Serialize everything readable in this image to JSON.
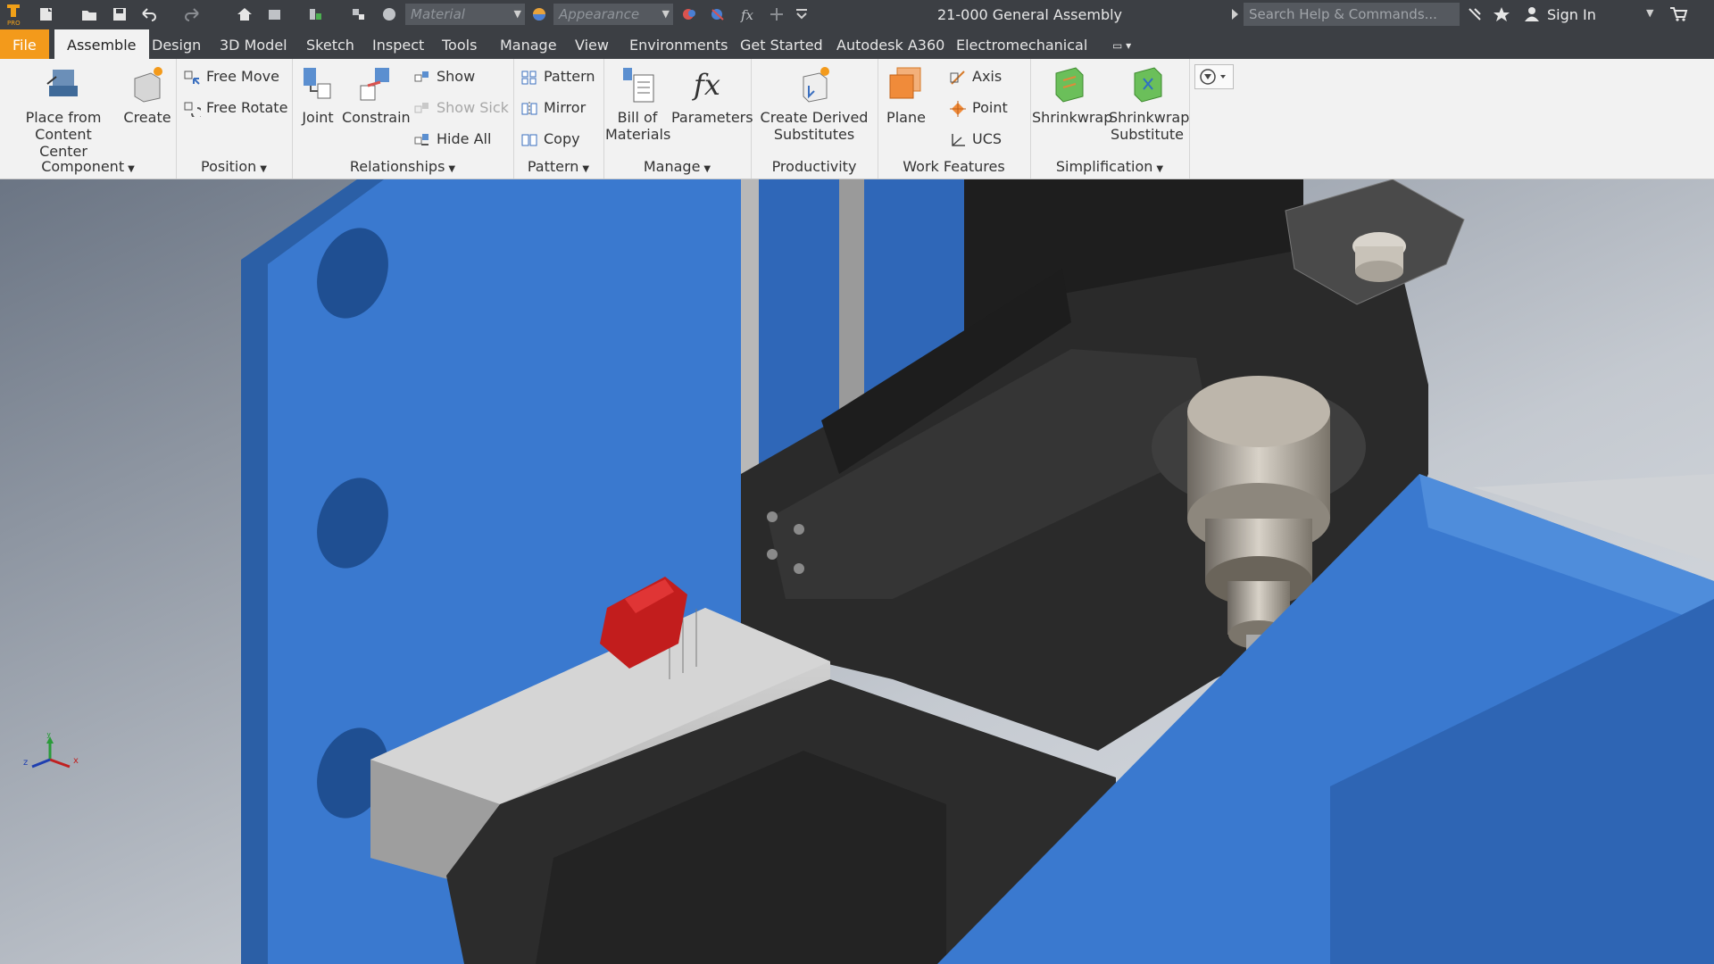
{
  "qat": {
    "material_placeholder": "Material",
    "appearance_placeholder": "Appearance",
    "document_title": "21-000 General Assembly",
    "search_placeholder": "Search Help & Commands...",
    "sign_in": "Sign In"
  },
  "tabs": [
    "File",
    "Assemble",
    "Design",
    "3D Model",
    "Sketch",
    "Inspect",
    "Tools",
    "Manage",
    "View",
    "Environments",
    "Get Started",
    "Autodesk A360",
    "Electromechanical"
  ],
  "active_tab": "Assemble",
  "ribbon": {
    "component": {
      "label": "Component",
      "place_l1": "Place from",
      "place_l2": "Content Center",
      "create": "Create"
    },
    "position": {
      "label": "Position",
      "free_move": "Free Move",
      "free_rotate": "Free Rotate"
    },
    "relationships": {
      "label": "Relationships",
      "joint": "Joint",
      "constrain": "Constrain",
      "show": "Show",
      "show_sick": "Show Sick",
      "hide_all": "Hide All"
    },
    "pattern": {
      "label": "Pattern",
      "pattern": "Pattern",
      "mirror": "Mirror",
      "copy": "Copy"
    },
    "manage": {
      "label": "Manage",
      "bom_l1": "Bill of",
      "bom_l2": "Materials",
      "parameters": "Parameters"
    },
    "productivity": {
      "label": "Productivity",
      "derived_l1": "Create Derived",
      "derived_l2": "Substitutes"
    },
    "work_features": {
      "label": "Work Features",
      "plane": "Plane",
      "axis": "Axis",
      "point": "Point",
      "ucs": "UCS"
    },
    "simplification": {
      "label": "Simplification",
      "shrinkwrap": "Shrinkwrap",
      "shrinkwrap_sub_l1": "Shrinkwrap",
      "shrinkwrap_sub_l2": "Substitute"
    }
  },
  "colors": {
    "file_tab": "#f39a1b",
    "machine_blue": "#2f6fc4",
    "dark_part": "#2a2a2a"
  }
}
